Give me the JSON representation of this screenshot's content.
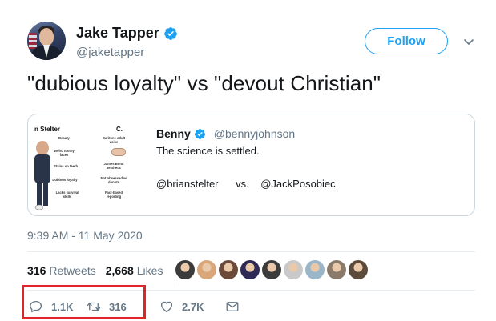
{
  "author": {
    "name": "Jake Tapper",
    "handle": "@jaketapper",
    "verified": true
  },
  "header": {
    "follow_label": "Follow",
    "caret_icon": "chevron-down-icon"
  },
  "tweet": {
    "text": "\"dubious loyalty\" vs \"devout Christian\"",
    "timestamp": "9:39 AM - 11 May 2020"
  },
  "quoted_tweet": {
    "name": "Benny",
    "handle": "@bennyjohnson",
    "verified": true,
    "line1": "The science is settled.",
    "line2": "@brianstelter      vs.    @JackPosobiec",
    "image": {
      "title_left": "n Stelter",
      "title_right": "C.",
      "left_labels": [
        "Beauty",
        "Weird toothy faces",
        "Stains on teeth",
        "Dubious loyalty",
        "Lacks survival skills"
      ],
      "right_labels": [
        "Baritone adult voice",
        "James Bond aesthetic",
        "Not obsessed w/ donuts",
        "Fact-based reporting"
      ]
    }
  },
  "stats": {
    "retweets_count": "316",
    "retweets_label": "Retweets",
    "likes_count": "2,668",
    "likes_label": "Likes"
  },
  "likers": [
    "#3b3b3b",
    "#d9a67a",
    "#6b4a3a",
    "#2e2a55",
    "#3c3c3c",
    "#c9c9c9",
    "#9ab7c9",
    "#8a7a6a",
    "#5c4a3a"
  ],
  "actions": {
    "reply_count": "1.1K",
    "retweet_count": "316",
    "like_count": "2.7K"
  },
  "colors": {
    "accent": "#1da1f2",
    "highlight": "#e0242b",
    "muted": "#657786"
  }
}
